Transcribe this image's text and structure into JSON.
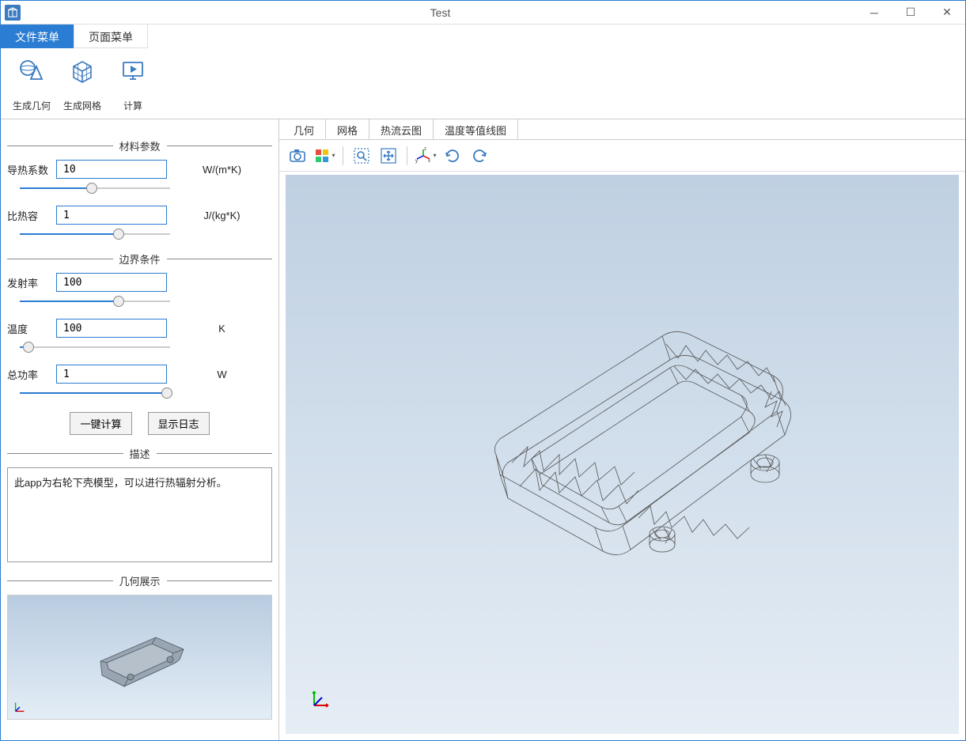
{
  "window": {
    "title": "Test"
  },
  "ribbon": {
    "tabs": [
      {
        "label": "文件菜单",
        "active": true
      },
      {
        "label": "页面菜单",
        "active": false
      }
    ],
    "items": [
      {
        "label": "生成几何",
        "icon": "sphere-cone-icon"
      },
      {
        "label": "生成网格",
        "icon": "mesh-cube-icon"
      },
      {
        "label": "计算",
        "icon": "play-monitor-icon"
      }
    ]
  },
  "sidebar": {
    "sections": {
      "material": {
        "title": "材料参数",
        "params": [
          {
            "label": "导热系数",
            "value": "10",
            "unit": "W/(m*K)",
            "slider_percent": 48
          },
          {
            "label": "比热容",
            "value": "1",
            "unit": "J/(kg*K)",
            "slider_percent": 66
          }
        ]
      },
      "boundary": {
        "title": "边界条件",
        "params": [
          {
            "label": "发射率",
            "value": "100",
            "unit": "",
            "slider_percent": 66
          },
          {
            "label": "温度",
            "value": "100",
            "unit": "K",
            "slider_percent": 6
          },
          {
            "label": "总功率",
            "value": "1",
            "unit": "W",
            "slider_percent": 98
          }
        ]
      },
      "buttons": {
        "compute": "一键计算",
        "showlog": "显示日志"
      },
      "description": {
        "title": "描述",
        "text": "此app为右轮下壳模型，可以进行热辐射分析。"
      },
      "geometry_display": {
        "title": "几何展示"
      }
    }
  },
  "viewport": {
    "tabs": [
      {
        "label": "几何"
      },
      {
        "label": "网格"
      },
      {
        "label": "热流云图"
      },
      {
        "label": "温度等值线图"
      }
    ]
  }
}
